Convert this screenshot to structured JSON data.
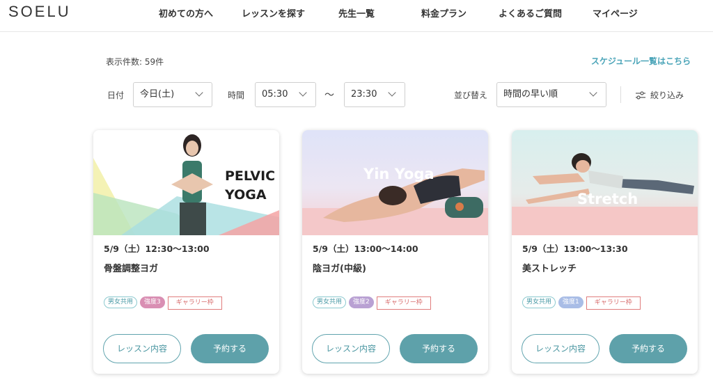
{
  "header": {
    "logo": "SOELU",
    "nav": [
      "初めての方へ",
      "レッスンを探す",
      "先生一覧",
      "料金プラン",
      "よくあるご質問",
      "マイページ"
    ]
  },
  "results": {
    "count_label": "表示件数: 59件",
    "schedule_link": "スケジュール一覧はこちら"
  },
  "filters": {
    "date_label": "日付",
    "date_value": "今日(土)",
    "time_label": "時間",
    "time_from": "05:30",
    "time_sep": "〜",
    "time_to": "23:30",
    "sort_label": "並び替え",
    "sort_value": "時間の早い順",
    "filter_button": "絞り込み"
  },
  "cards": [
    {
      "image_text": [
        "PELVIC",
        "YOGA"
      ],
      "time": "5/9（土）12:30〜13:00",
      "title": "骨盤調整ヨガ",
      "tags": {
        "gender": "男女共用",
        "intensity": "強度3",
        "gallery": "ギャラリー枠"
      },
      "detail_button": "レッスン内容",
      "book_button": "予約する"
    },
    {
      "image_text": [
        "Yin Yoga"
      ],
      "time": "5/9（土）13:00〜14:00",
      "title": "陰ヨガ(中級)",
      "tags": {
        "gender": "男女共用",
        "intensity": "強度2",
        "gallery": "ギャラリー枠"
      },
      "detail_button": "レッスン内容",
      "book_button": "予約する"
    },
    {
      "image_text": [
        "Stretch"
      ],
      "time": "5/9（土）13:00〜13:30",
      "title": "美ストレッチ",
      "tags": {
        "gender": "男女共用",
        "intensity": "強度1",
        "gallery": "ギャラリー枠"
      },
      "detail_button": "レッスン内容",
      "book_button": "予約する"
    }
  ],
  "colors": {
    "accent": "#5ea1aa",
    "link": "#4aa4b8",
    "gallery_border": "#e07c7c"
  }
}
